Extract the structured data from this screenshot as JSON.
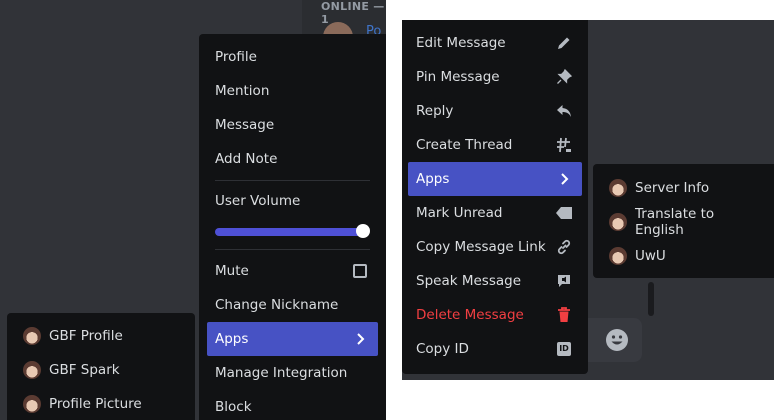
{
  "left_panel": {
    "online_header": "ONLINE — 1",
    "member_name": "Po"
  },
  "user_menu": {
    "items_top": [
      "Profile",
      "Mention",
      "Message",
      "Add Note"
    ],
    "volume_label": "User Volume",
    "volume_level": 1.0,
    "mute_label": "Mute",
    "change_nickname_label": "Change Nickname",
    "apps_label": "Apps",
    "manage_integration_label": "Manage Integration",
    "block_label": "Block"
  },
  "apps_submenu_left": {
    "items": [
      "GBF Profile",
      "GBF Spark",
      "Profile Picture"
    ]
  },
  "message_menu": {
    "edit_label": "Edit Message",
    "pin_label": "Pin Message",
    "reply_label": "Reply",
    "thread_label": "Create Thread",
    "apps_label": "Apps",
    "mark_unread_label": "Mark Unread",
    "copy_link_label": "Copy Message Link",
    "speak_label": "Speak Message",
    "delete_label": "Delete Message",
    "copy_id_label": "Copy ID",
    "copy_id_badge": "ID"
  },
  "apps_submenu_right": {
    "items": [
      "Server Info",
      "Translate to English",
      "UwU"
    ]
  },
  "colors": {
    "accent": "#4752c4",
    "danger": "#f23f42",
    "menu_bg": "#111214",
    "backdrop": "#313338"
  }
}
